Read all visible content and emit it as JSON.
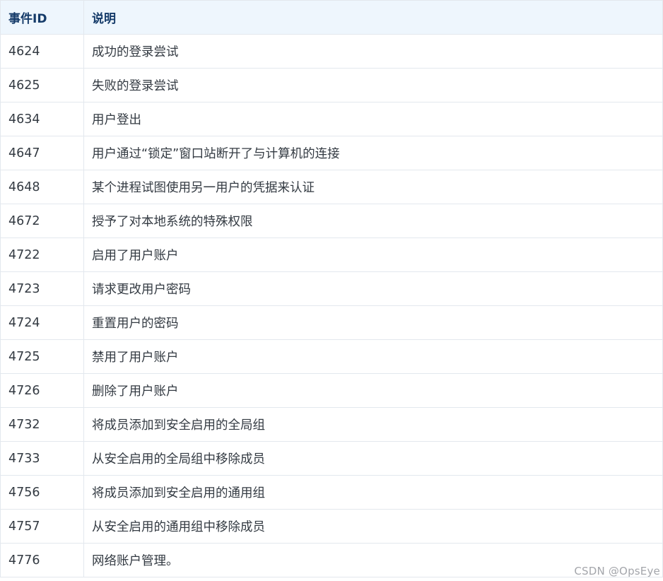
{
  "table": {
    "headers": [
      "事件ID",
      "说明"
    ],
    "rows": [
      {
        "id": "4624",
        "desc": "成功的登录尝试"
      },
      {
        "id": "4625",
        "desc": "失败的登录尝试"
      },
      {
        "id": "4634",
        "desc": "用户登出"
      },
      {
        "id": "4647",
        "desc": "用户通过“锁定”窗口站断开了与计算机的连接"
      },
      {
        "id": "4648",
        "desc": "某个进程试图使用另一用户的凭据来认证"
      },
      {
        "id": "4672",
        "desc": "授予了对本地系统的特殊权限"
      },
      {
        "id": "4722",
        "desc": "启用了用户账户"
      },
      {
        "id": "4723",
        "desc": "请求更改用户密码"
      },
      {
        "id": "4724",
        "desc": "重置用户的密码"
      },
      {
        "id": "4725",
        "desc": "禁用了用户账户"
      },
      {
        "id": "4726",
        "desc": "删除了用户账户"
      },
      {
        "id": "4732",
        "desc": "将成员添加到安全启用的全局组"
      },
      {
        "id": "4733",
        "desc": "从安全启用的全局组中移除成员"
      },
      {
        "id": "4756",
        "desc": "将成员添加到安全启用的通用组"
      },
      {
        "id": "4757",
        "desc": "从安全启用的通用组中移除成员"
      },
      {
        "id": "4776",
        "desc": "网络账户管理。"
      }
    ]
  },
  "watermark": "CSDN @OpsEye",
  "colors": {
    "header_background": "#eef6fd",
    "header_text": "#153b69",
    "body_text": "#333a42",
    "border": "#e3e8ee"
  }
}
